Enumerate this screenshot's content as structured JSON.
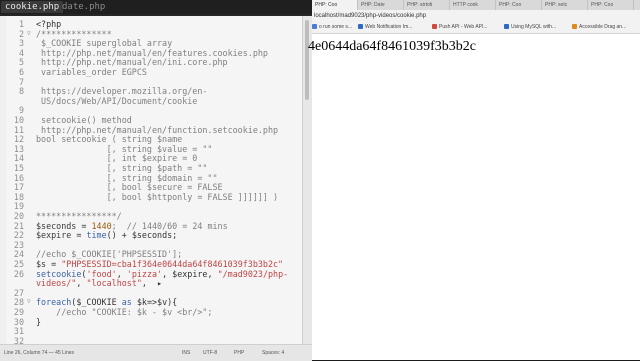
{
  "editor": {
    "tabs": [
      {
        "label": "cookie.php",
        "active": true
      },
      {
        "label": "date.php",
        "active": false
      }
    ],
    "lines": [
      {
        "n": "1",
        "fold": "",
        "segments": [
          {
            "t": "<?php",
            "c": "c-plain"
          }
        ]
      },
      {
        "n": "2",
        "fold": "▽",
        "segments": [
          {
            "t": "/**************",
            "c": "c-comment"
          }
        ]
      },
      {
        "n": "3",
        "fold": "",
        "segments": [
          {
            "t": " $_COOKIE superglobal array",
            "c": "c-comment"
          }
        ]
      },
      {
        "n": "4",
        "fold": "",
        "segments": [
          {
            "t": " http://php.net/manual/en/features.cookies.php",
            "c": "c-comment"
          }
        ]
      },
      {
        "n": "5",
        "fold": "",
        "segments": [
          {
            "t": " http://php.net/manual/en/ini.core.php",
            "c": "c-comment"
          }
        ]
      },
      {
        "n": "6",
        "fold": "",
        "segments": [
          {
            "t": " variables_order EGPCS",
            "c": "c-comment"
          }
        ]
      },
      {
        "n": "7",
        "fold": "",
        "segments": []
      },
      {
        "n": "8",
        "fold": "",
        "segments": [
          {
            "t": " https://developer.mozilla.org/en-",
            "c": "c-comment"
          }
        ]
      },
      {
        "n": "",
        "fold": "",
        "segments": [
          {
            "t": " US/docs/Web/API/Document/cookie",
            "c": "c-comment"
          }
        ]
      },
      {
        "n": "9",
        "fold": "",
        "segments": []
      },
      {
        "n": "10",
        "fold": "",
        "segments": [
          {
            "t": " setcookie() method",
            "c": "c-comment"
          }
        ]
      },
      {
        "n": "11",
        "fold": "",
        "segments": [
          {
            "t": " http://php.net/manual/en/function.setcookie.php",
            "c": "c-comment"
          }
        ]
      },
      {
        "n": "12",
        "fold": "",
        "segments": [
          {
            "t": "bool setcookie ( string $name",
            "c": "c-comment"
          }
        ]
      },
      {
        "n": "13",
        "fold": "",
        "segments": [
          {
            "t": "              [, string $value = \"\"",
            "c": "c-comment"
          }
        ]
      },
      {
        "n": "14",
        "fold": "",
        "segments": [
          {
            "t": "              [, int $expire = 0",
            "c": "c-comment"
          }
        ]
      },
      {
        "n": "15",
        "fold": "",
        "segments": [
          {
            "t": "              [, string $path = \"\"",
            "c": "c-comment"
          }
        ]
      },
      {
        "n": "16",
        "fold": "",
        "segments": [
          {
            "t": "              [, string $domain = \"\"",
            "c": "c-comment"
          }
        ]
      },
      {
        "n": "17",
        "fold": "",
        "segments": [
          {
            "t": "              [, bool $secure = FALSE",
            "c": "c-comment"
          }
        ]
      },
      {
        "n": "18",
        "fold": "",
        "segments": [
          {
            "t": "              [, bool $httponly = FALSE ]]]]]] )",
            "c": "c-comment"
          }
        ]
      },
      {
        "n": "19",
        "fold": "",
        "segments": []
      },
      {
        "n": "20",
        "fold": "",
        "segments": [
          {
            "t": "****************/",
            "c": "c-comment"
          }
        ]
      },
      {
        "n": "21",
        "fold": "",
        "segments": [
          {
            "t": "$seconds",
            "c": "c-var"
          },
          {
            "t": " = ",
            "c": "c-plain"
          },
          {
            "t": "1440",
            "c": "c-fn"
          },
          {
            "t": ";  // 1440/60 = 24 mins",
            "c": "c-comment"
          }
        ]
      },
      {
        "n": "22",
        "fold": "",
        "segments": [
          {
            "t": "$expire",
            "c": "c-var"
          },
          {
            "t": " = ",
            "c": "c-plain"
          },
          {
            "t": "time",
            "c": "c-kw"
          },
          {
            "t": "() + $seconds;",
            "c": "c-plain"
          }
        ]
      },
      {
        "n": "23",
        "fold": "",
        "segments": []
      },
      {
        "n": "24",
        "fold": "",
        "segments": [
          {
            "t": "//echo $_COOKIE['PHPSESSID'];",
            "c": "c-comment"
          }
        ]
      },
      {
        "n": "25",
        "fold": "",
        "segments": [
          {
            "t": "$s",
            "c": "c-var"
          },
          {
            "t": " = ",
            "c": "c-plain"
          },
          {
            "t": "\"PHPSESSID=cba1f364e0644da64f8461039f3b3b2c\"",
            "c": "c-str"
          }
        ]
      },
      {
        "n": "26",
        "fold": "",
        "segments": [
          {
            "t": "setcookie",
            "c": "c-kw"
          },
          {
            "t": "(",
            "c": "c-plain"
          },
          {
            "t": "'food'",
            "c": "c-str"
          },
          {
            "t": ", ",
            "c": "c-plain"
          },
          {
            "t": "'pizza'",
            "c": "c-str"
          },
          {
            "t": ", $expire, ",
            "c": "c-plain"
          },
          {
            "t": "\"/mad9023/php-",
            "c": "c-str"
          }
        ]
      },
      {
        "n": "",
        "fold": "",
        "segments": [
          {
            "t": "videos/\"",
            "c": "c-str"
          },
          {
            "t": ", ",
            "c": "c-plain"
          },
          {
            "t": "\"localhost\"",
            "c": "c-str"
          },
          {
            "t": ",  ▸",
            "c": "c-plain"
          }
        ]
      },
      {
        "n": "27",
        "fold": "",
        "segments": []
      },
      {
        "n": "28",
        "fold": "▽",
        "segments": [
          {
            "t": "foreach",
            "c": "c-kw"
          },
          {
            "t": "($_COOKIE ",
            "c": "c-plain"
          },
          {
            "t": "as",
            "c": "c-kw"
          },
          {
            "t": " $k=>$v){",
            "c": "c-plain"
          }
        ]
      },
      {
        "n": "29",
        "fold": "",
        "segments": [
          {
            "t": "    //echo \"COOKIE: $k - $v <br/>\";",
            "c": "c-comment"
          }
        ]
      },
      {
        "n": "30",
        "fold": "",
        "segments": [
          {
            "t": "}",
            "c": "c-plain"
          }
        ]
      },
      {
        "n": "31",
        "fold": "",
        "segments": []
      },
      {
        "n": "32",
        "fold": "",
        "segments": []
      }
    ],
    "status": {
      "position": "Line 26, Column 74 — 45 Lines",
      "mode": "INS",
      "encoding": "UTF-8",
      "language": "PHP",
      "spaces": "Spaces: 4"
    }
  },
  "browser": {
    "tabs": [
      "PHP: Coo",
      "PHP: Date",
      "PHP: strtoti",
      "HTTP cook",
      "PHP: Coo",
      "PHP: setc",
      "PHP: Coo"
    ],
    "address": "localhost/mad9023/php-videos/cookie.php",
    "bookmarks": [
      {
        "label": "o run some s...",
        "icon": "blue"
      },
      {
        "label": "Web Notification Im...",
        "icon": "blue2"
      },
      {
        "label": "Push API - Web API...",
        "icon": "red"
      },
      {
        "label": "Using MySQL with...",
        "icon": "blue2"
      },
      {
        "label": "Accessible Drag an...",
        "icon": "orange"
      }
    ],
    "output": "4e0644da64f8461039f3b3b2c"
  }
}
